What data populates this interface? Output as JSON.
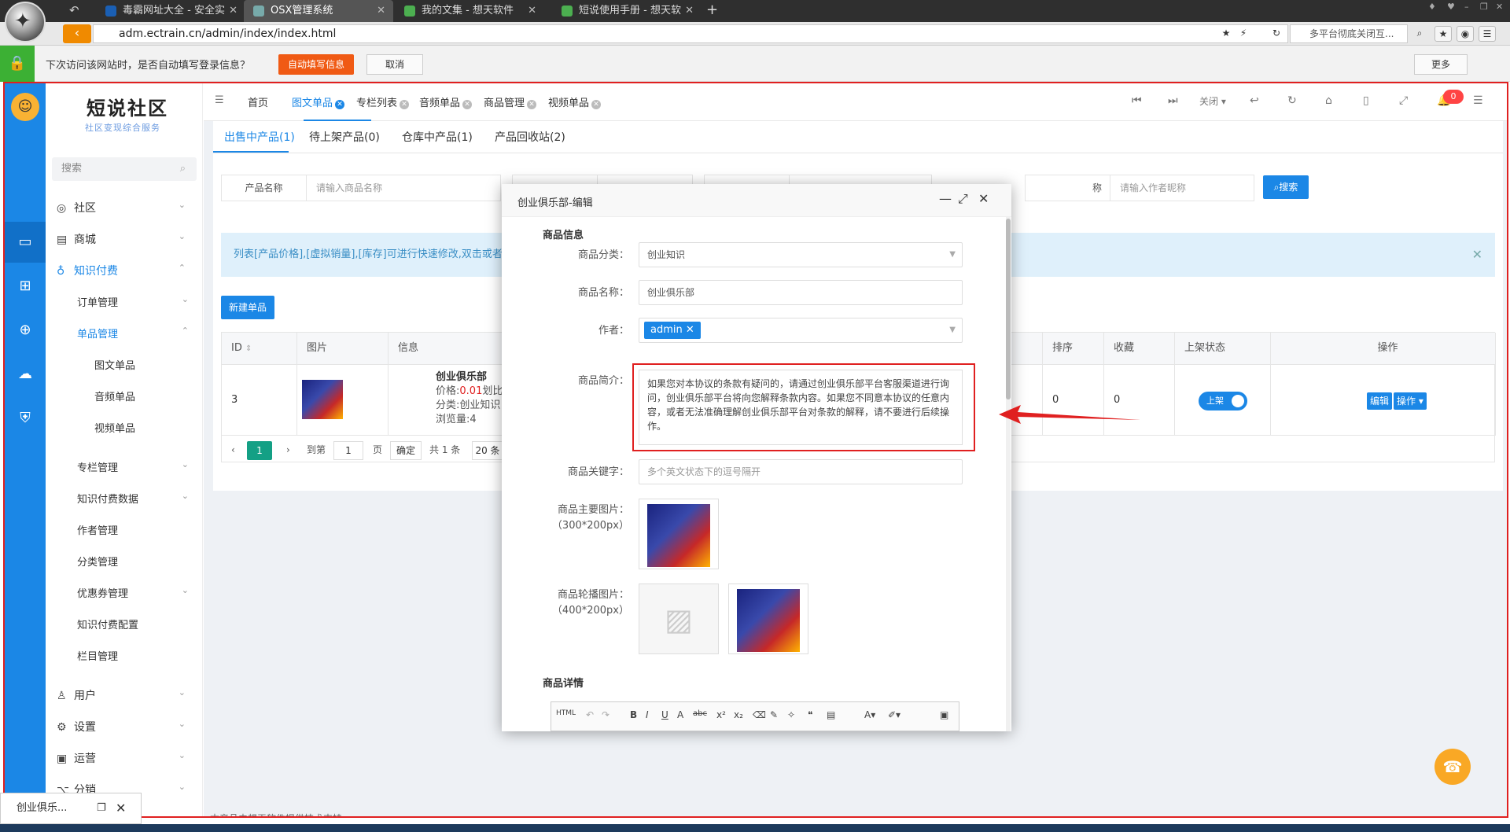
{
  "browser": {
    "tabs": [
      {
        "label": "毒霸网址大全 - 安全实",
        "color": "#1a5fb4",
        "active": false
      },
      {
        "label": "OSX管理系统",
        "color": "#7aa",
        "active": true
      },
      {
        "label": "我的文集 - 想天软件",
        "color": "#4caf50",
        "active": false
      },
      {
        "label": "短说使用手册 - 想天软",
        "color": "#4caf50",
        "active": false
      }
    ],
    "new_tab": "+",
    "url": "adm.ectrain.cn/admin/index/index.html",
    "search_text": "多平台彻底关闭互..."
  },
  "password_bar": {
    "message": "下次访问该网站时，是否自动填写登录信息？",
    "autofill_label": "自动填写信息",
    "cancel_label": "取消",
    "more_label": "更多"
  },
  "sidebar": {
    "brand": "短说社区",
    "brand_sub": "社区变现综合服务",
    "search_placeholder": "搜索",
    "menu": [
      {
        "label": "社区"
      },
      {
        "label": "商城"
      },
      {
        "label": "知识付费"
      },
      {
        "label": "订单管理"
      },
      {
        "label": "单品管理"
      },
      {
        "label": "图文单品"
      },
      {
        "label": "音频单品"
      },
      {
        "label": "视频单品"
      },
      {
        "label": "专栏管理"
      },
      {
        "label": "知识付费数据"
      },
      {
        "label": "作者管理"
      },
      {
        "label": "分类管理"
      },
      {
        "label": "优惠券管理"
      },
      {
        "label": "知识付费配置"
      },
      {
        "label": "栏目管理"
      },
      {
        "label": "用户"
      },
      {
        "label": "设置"
      },
      {
        "label": "运营"
      },
      {
        "label": "分销"
      }
    ]
  },
  "topnav": {
    "tabs": [
      "首页",
      "图文单品",
      "专栏列表",
      "音频单品",
      "商品管理",
      "视频单品"
    ],
    "close_label": "关闭",
    "badge": "0"
  },
  "content": {
    "subtabs": [
      "出售中产品(1)",
      "待上架产品(0)",
      "仓库中产品(1)",
      "产品回收站(2)"
    ],
    "filter_name_label": "产品名称",
    "filter_name_placeholder": "请输入商品名称",
    "filter_author_label": "称",
    "filter_author_placeholder": "请输入作者昵称",
    "search_label": "搜索",
    "notice": "列表[产品价格],[虚拟销量],[库存]可进行快速修改,双击或者",
    "new_label": "新建单品",
    "columns": [
      "ID",
      "图片",
      "信息",
      "排序",
      "收藏",
      "上架状态",
      "操作"
    ],
    "row": {
      "id": "3",
      "name": "创业俱乐部",
      "price_prefix": "价格:",
      "price": "0.01",
      "price_suffix": "划比",
      "category": "分类:创业知识",
      "views": "浏览量:4",
      "sort": "0",
      "fav": "0",
      "status": "上架",
      "edit": "编辑",
      "ops": "操作"
    },
    "pager": {
      "current": "1",
      "goto": "到第",
      "page_input": "1",
      "page_unit": "页",
      "confirm": "确定",
      "total": "共 1 条",
      "per_page": "20 条"
    },
    "footer": "本产品由想天软件提供技术支持"
  },
  "modal": {
    "title": "创业俱乐部-编辑",
    "section_info": "商品信息",
    "category_label": "商品分类：",
    "category_value": "创业知识",
    "name_label": "商品名称：",
    "name_value": "创业俱乐部",
    "author_label": "作者：",
    "author_tag": "admin",
    "intro_label": "商品简介：",
    "intro_value": "如果您对本协议的条款有疑问的，请通过创业俱乐部平台客服渠道进行询问，创业俱乐部平台将向您解释条款内容。如果您不同意本协议的任意内容，或者无法准确理解创业俱乐部平台对条款的解释，请不要进行后续操作。",
    "keywords_label": "商品关键字：",
    "keywords_placeholder": "多个英文状态下的逗号隔开",
    "main_img_label": "商品主要图片：",
    "main_img_size": "（300*200px）",
    "carousel_label": "商品轮播图片：",
    "carousel_size": "（400*200px）",
    "section_detail": "商品详情",
    "editor_html": "HTML"
  },
  "minimized": {
    "label": "创业俱乐..."
  }
}
